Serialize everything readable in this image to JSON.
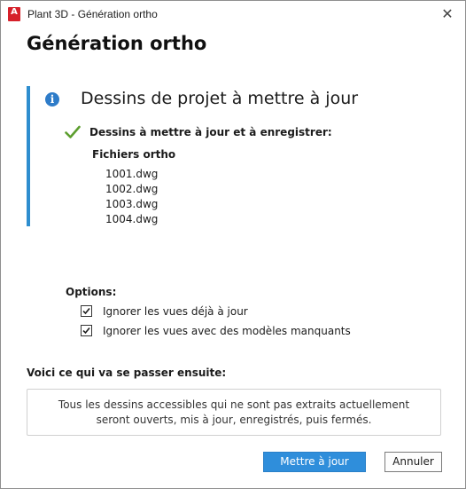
{
  "window": {
    "title": "Plant 3D - Génération ortho",
    "app_icon": "autocad-plant-3d-icon",
    "close_label": "✕"
  },
  "heading": "Génération ortho",
  "info": {
    "icon": "info-icon",
    "title": "Dessins de projet à mettre à jour",
    "status_icon": "checkmark-icon",
    "status_label": "Dessins à mettre à jour et à enregistrer:",
    "files_heading": "Fichiers ortho",
    "files": [
      "1001.dwg",
      "1002.dwg",
      "1003.dwg",
      "1004.dwg"
    ]
  },
  "options": {
    "label": "Options:",
    "items": [
      {
        "label": "Ignorer les vues déjà à jour",
        "checked": true
      },
      {
        "label": "Ignorer les vues avec des modèles manquants",
        "checked": true
      }
    ]
  },
  "next": {
    "heading": "Voici ce qui va se passer ensuite:",
    "line1": "Tous les dessins accessibles qui ne sont pas extraits actuellement",
    "line2": "seront ouverts, mis à jour, enregistrés, puis fermés."
  },
  "buttons": {
    "primary": "Mettre à jour",
    "secondary": "Annuler"
  },
  "colors": {
    "accent": "#2e8ecf",
    "primary_button": "#2f8edb",
    "check": "#5c9e2e",
    "app_icon": "#d6202a"
  }
}
